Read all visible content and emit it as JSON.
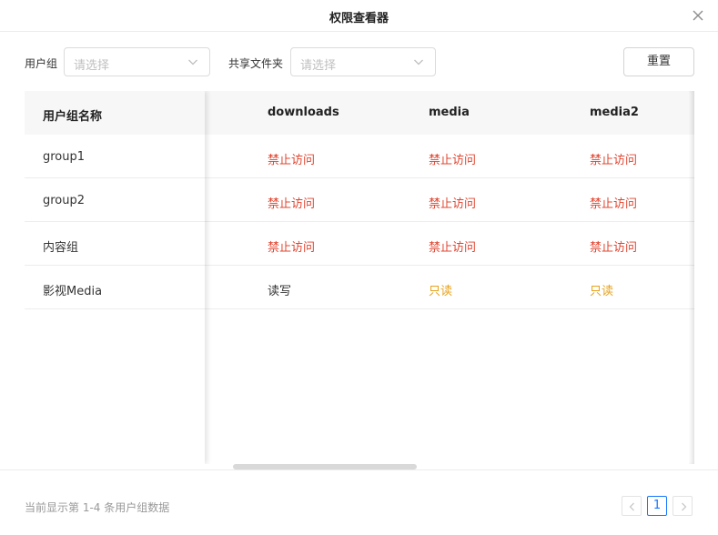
{
  "dialog": {
    "title": "权限查看器"
  },
  "filters": {
    "user_group_label": "用户组",
    "user_group_placeholder": "请选择",
    "shared_folder_label": "共享文件夹",
    "shared_folder_placeholder": "请选择",
    "reset_label": "重置"
  },
  "table": {
    "fixed_header": "用户组名称",
    "columns": [
      "downloads",
      "media",
      "media2"
    ],
    "rows": [
      {
        "name": "group1",
        "perms": [
          "禁止访问",
          "禁止访问",
          "禁止访问"
        ]
      },
      {
        "name": "group2",
        "perms": [
          "禁止访问",
          "禁止访问",
          "禁止访问"
        ]
      },
      {
        "name": "内容组",
        "perms": [
          "禁止访问",
          "禁止访问",
          "禁止访问"
        ]
      },
      {
        "name": "影视Media",
        "perms": [
          "读写",
          "只读",
          "只读"
        ]
      }
    ]
  },
  "footer": {
    "summary": "当前显示第 1-4 条用户组数据"
  },
  "pagination": {
    "current_page": "1"
  },
  "colors": {
    "deny": "#e0442f",
    "readonly": "#e8a21a",
    "readwrite": "#333333",
    "accent": "#1677ff"
  },
  "icons": {
    "close": "close-icon",
    "dropdown": "chevron-down-icon",
    "prev": "chevron-left-icon",
    "next": "chevron-right-icon"
  }
}
